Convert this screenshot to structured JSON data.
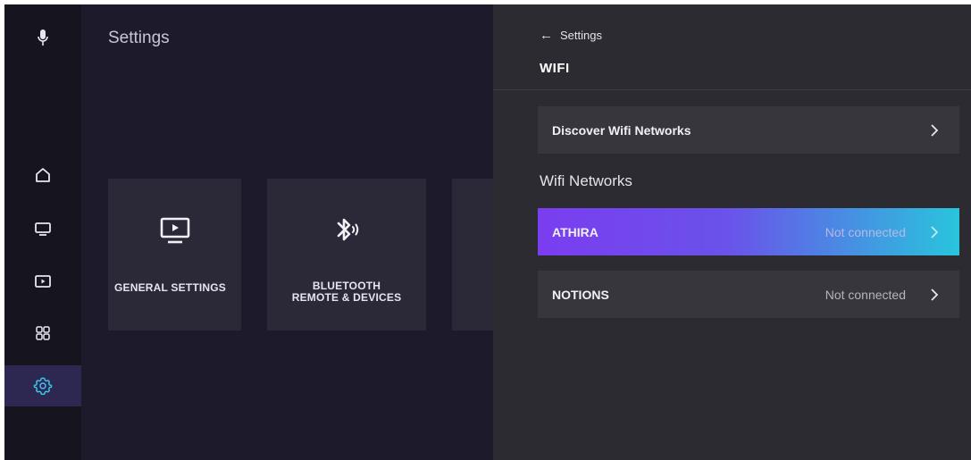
{
  "main": {
    "title": "Settings",
    "tiles": [
      {
        "label": "GENERAL SETTINGS",
        "icon": "tv-icon"
      },
      {
        "label": "BLUETOOTH\nREMOTE & DEVICES",
        "icon": "bluetooth-audio-icon"
      }
    ]
  },
  "rail": {
    "items": [
      "mic-icon",
      "home-icon",
      "tv-icon",
      "media-icon",
      "apps-icon",
      "settings-icon"
    ],
    "active_color": "#2d2852",
    "active_icon_color": "#3fc6e6"
  },
  "panel": {
    "back_label": "Settings",
    "title": "WIFI",
    "discover_label": "Discover Wifi Networks",
    "section_label": "Wifi Networks",
    "networks": [
      {
        "name": "ATHIRA",
        "status": "Not connected"
      },
      {
        "name": "NOTIONS",
        "status": "Not connected"
      }
    ]
  },
  "colors": {
    "highlight_start": "#7a3df0",
    "highlight_end": "#29c4dc",
    "background": "#1d1a2b",
    "panel": "#2c2b31"
  }
}
